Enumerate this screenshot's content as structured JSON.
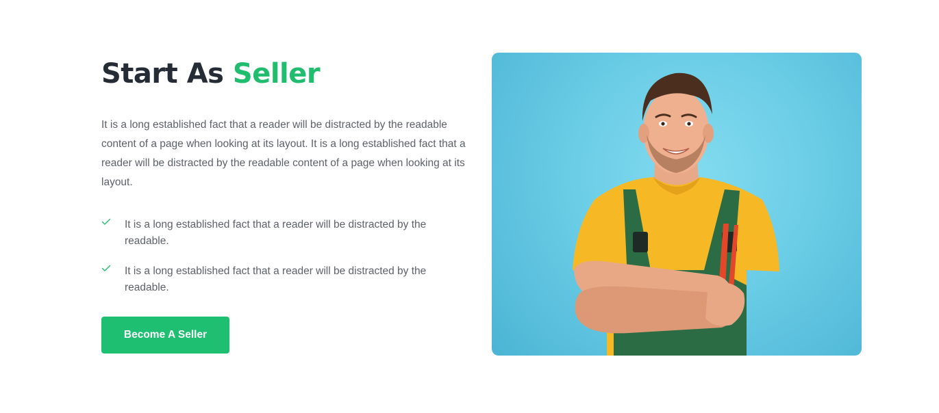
{
  "section": {
    "title_prefix": "Start As",
    "title_accent": "Seller",
    "description": "It is a long established fact that a reader will be distracted by the readable content of a page when looking at its layout. It is a long established fact that a reader will be distracted by the readable content of a page when looking at its layout.",
    "features": [
      {
        "icon": "check-icon",
        "text": "It is a long established fact that a reader will be distracted by the readable."
      },
      {
        "icon": "check-icon",
        "text": "It is a long established fact that a reader will be distracted by the readable."
      }
    ],
    "cta_label": "Become A Seller"
  },
  "colors": {
    "accent": "#1fbd6d",
    "heading": "#262c36",
    "body_text": "#5d6168",
    "button_bg": "#1fbf71",
    "image_bg": "#6bcde6"
  }
}
